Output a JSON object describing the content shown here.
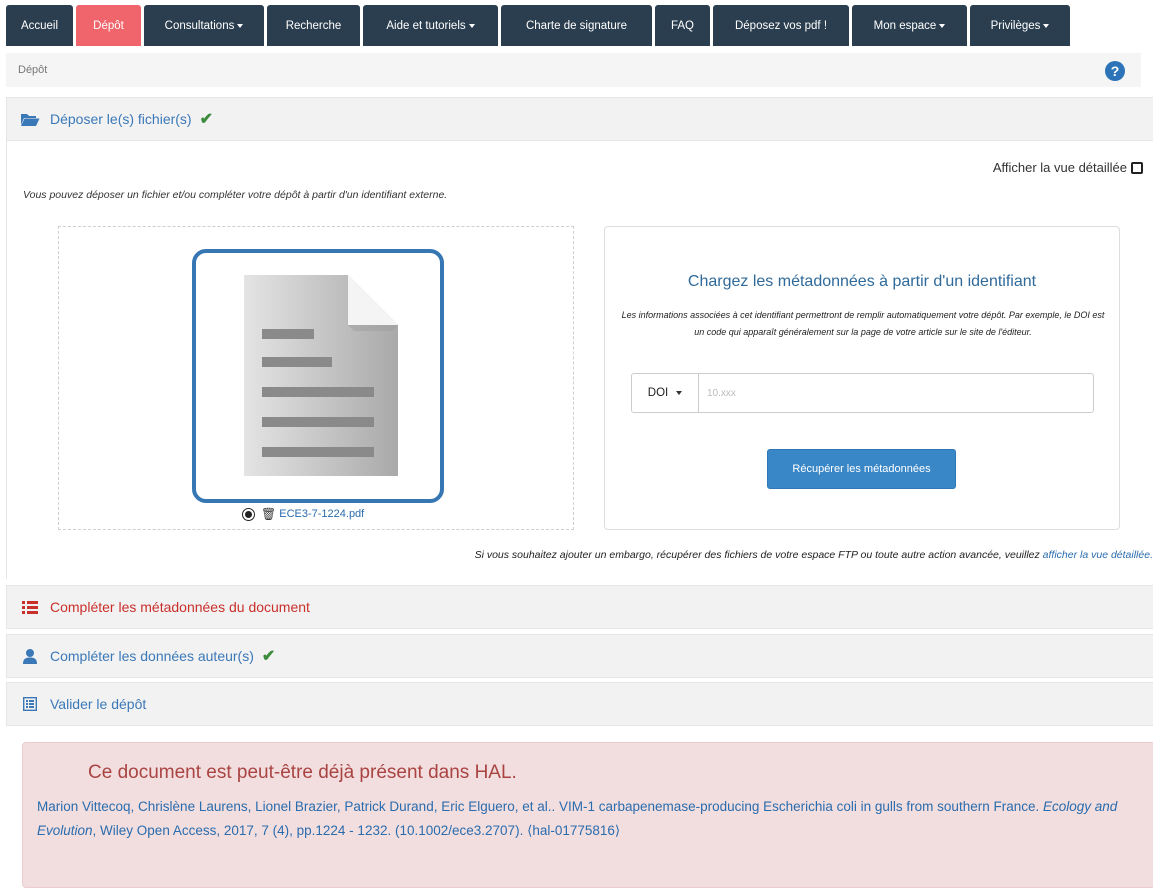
{
  "nav": {
    "tabs": [
      {
        "label": "Accueil",
        "active": false,
        "dropdown": false
      },
      {
        "label": "Dépôt",
        "active": true,
        "dropdown": false
      },
      {
        "label": "Consultations",
        "active": false,
        "dropdown": true
      },
      {
        "label": "Recherche",
        "active": false,
        "dropdown": false
      },
      {
        "label": "Aide et tutoriels",
        "active": false,
        "dropdown": true
      },
      {
        "label": "Charte de signature",
        "active": false,
        "dropdown": false
      },
      {
        "label": "FAQ",
        "active": false,
        "dropdown": false
      },
      {
        "label": "Déposez vos pdf !",
        "active": false,
        "dropdown": false
      },
      {
        "label": "Mon espace",
        "active": false,
        "dropdown": true
      },
      {
        "label": "Privilèges",
        "active": false,
        "dropdown": true
      }
    ]
  },
  "breadcrumb": {
    "label": "Dépôt",
    "help_glyph": "?"
  },
  "sections": {
    "upload": {
      "title": "Déposer le(s) fichier(s)",
      "check": "✔"
    },
    "metadata": {
      "title": "Compléter les métadonnées du document"
    },
    "authors": {
      "title": "Compléter les données auteur(s)",
      "check": "✔"
    },
    "validate": {
      "title": "Valider le dépôt"
    }
  },
  "upload": {
    "detailed_view_label": "Afficher la vue détaillée",
    "intro": "Vous pouvez déposer un fichier et/ou compléter votre dépôt à partir d'un identifiant externe.",
    "file": {
      "name": "ECE3-7-1224.pdf"
    },
    "identifier_box": {
      "title": "Chargez les métadonnées à partir d'un identifiant",
      "description": "Les informations associées à cet identifiant permettront de remplir automatiquement votre dépôt. Par exemple, le DOI est un code qui apparaît généralement sur la page de votre article sur le site de l'éditeur.",
      "select_value": "DOI",
      "input_placeholder": "10.xxx",
      "input_value": "",
      "button_label": "Récupérer les métadonnées"
    },
    "embargo_text": "Si vous souhaitez ajouter un embargo, récupérer des fichiers de votre espace FTP ou toute autre action avancée, veuillez ",
    "embargo_link": "afficher la vue détaillée."
  },
  "alert": {
    "title": "Ce document est peut-être déjà présent dans HAL.",
    "authors": "Marion Vittecoq, Chrislène Laurens, Lionel Brazier, Patrick Durand, Eric Elguero, et al.. VIM-1 carbapenemase-producing Escherichia coli in gulls from southern France. ",
    "journal": "Ecology and Evolution",
    "details": ", Wiley Open Access, 2017, 7 (4), pp.1224 - 1232. (10.1002/ece3.2707). ⟨hal-01775816⟩"
  },
  "colors": {
    "nav_bg": "#2b3e4f",
    "nav_active": "#f0646c",
    "link": "#2a6cae",
    "primary_button": "#3a87c8",
    "alert_bg": "#f2dede",
    "alert_title": "#a94442",
    "check_green": "#3d8b3d"
  },
  "icons": {
    "upload": "folder-open-icon",
    "metadata": "list-icon",
    "authors": "user-icon",
    "validate": "list-alt-icon",
    "file": "file-document-icon",
    "delete": "trash-icon",
    "help": "question-circle-icon"
  }
}
